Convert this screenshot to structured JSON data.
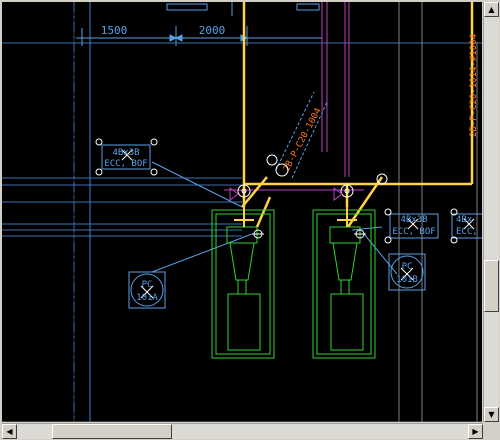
{
  "dimensions": {
    "dim_a": "1500",
    "dim_b": "2000"
  },
  "labels": {
    "pipe_line": "2B-P-C20-1014-#1004",
    "diagonal_pipe": "2B-P-C20-1004",
    "tag_left_line1": "4Bx3B",
    "tag_left_line2": "ECC, BOF",
    "tag_right_line1": "4Bx3B",
    "tag_right_line2": "ECC, BOF",
    "tag_far_line1": "4Bx",
    "tag_far_line2": "ECC,",
    "pump_left_line1": "PC",
    "pump_left_line2": "101A",
    "pump_right_line1": "PC",
    "pump_right_line2": "101B"
  },
  "scrollbars": {
    "up_arrow": "▲",
    "down_arrow": "▼",
    "left_arrow": "◀",
    "right_arrow": "▶"
  },
  "colors": {
    "background": "#000000",
    "pipe": "#ffd24a",
    "annotation": "#5aa0e6",
    "equipment": "#2fd52f",
    "magenta": "#c040c0",
    "orange_text": "#ff7a1a",
    "white": "#ffffff"
  }
}
